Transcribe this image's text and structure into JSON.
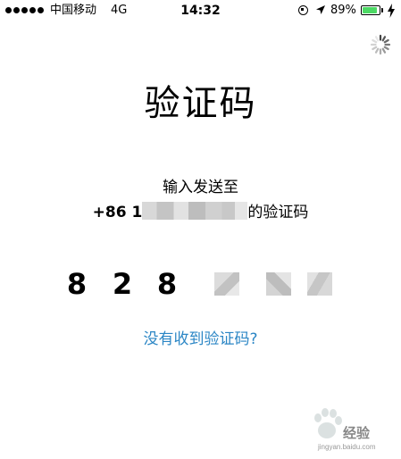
{
  "status_bar": {
    "carrier": "中国移动",
    "network": "4G",
    "time": "14:32",
    "battery_percent": "89%",
    "battery_level": 0.89,
    "icons": [
      "signal-dots-icon",
      "orientation-lock-icon",
      "location-arrow-icon",
      "battery-icon",
      "charging-bolt-icon"
    ]
  },
  "loading_indicator": "spinner-icon",
  "title": "验证码",
  "sent_to_label": "输入发送至",
  "phone": {
    "prefix": "+86 1",
    "suffix": "的验证码"
  },
  "code_digits": [
    "8",
    "2",
    "8"
  ],
  "link_text": "没有收到验证码?",
  "accent_color": "#2b86c5",
  "watermark": {
    "brand": "经验",
    "url": "jingyan.baidu.com"
  }
}
